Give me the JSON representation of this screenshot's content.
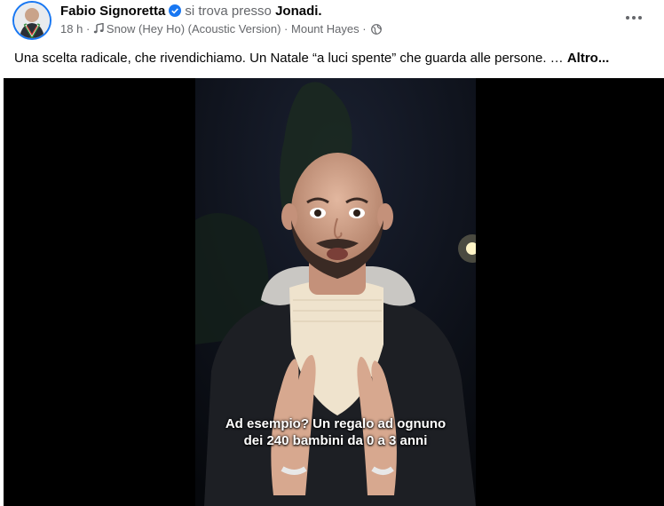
{
  "post": {
    "author": "Fabio Signoretta",
    "checkin_text": "si trova presso",
    "place": "Jonadi.",
    "time": "18 h",
    "separator": "·",
    "music": "Snow (Hey Ho) (Acoustic Version)",
    "location": "Mount Hayes",
    "caption": "Una scelta radicale, che rivendichiamo. Un Natale “a luci spente” che guarda alle persone. …",
    "see_more": "Altro..."
  },
  "video": {
    "subtitle": "Ad esempio? Un regalo ad ognuno dei 240 bambini da 0 a 3 anni"
  },
  "icons": {
    "verified": "verified-badge-icon",
    "music": "music-note-icon",
    "audience": "globe-icon",
    "more": "more-options-icon"
  },
  "colors": {
    "accent": "#1877f2",
    "muted_text": "#65676b",
    "primary_text": "#050505"
  }
}
